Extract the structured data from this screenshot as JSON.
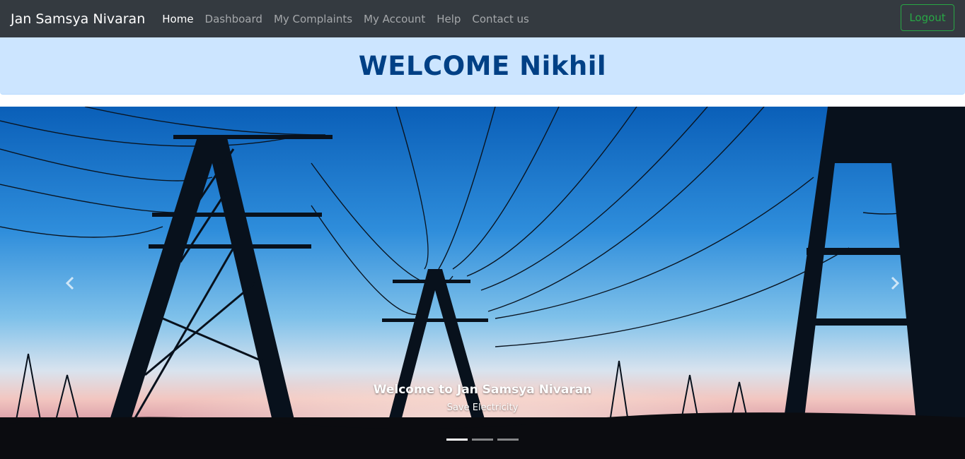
{
  "navbar": {
    "brand": "Jan Samsya Nivaran",
    "links": [
      {
        "label": "Home",
        "active": true
      },
      {
        "label": "Dashboard",
        "active": false
      },
      {
        "label": "My Complaints",
        "active": false
      },
      {
        "label": "My Account",
        "active": false
      },
      {
        "label": "Help",
        "active": false
      },
      {
        "label": "Contact us",
        "active": false
      }
    ],
    "logout_label": "Logout"
  },
  "welcome": {
    "heading": "WELCOME Nikhil"
  },
  "carousel": {
    "caption_title": "Welcome to Jan Samsya Nivaran",
    "caption_subtitle": "Save Electricity",
    "active_slide": 1,
    "slide_count": 3,
    "prev_icon": "chevron-left-icon",
    "next_icon": "chevron-right-icon"
  },
  "colors": {
    "navbar_bg": "#343a40",
    "welcome_bg": "#cce5ff",
    "welcome_text": "#004085",
    "logout": "#28a745"
  }
}
